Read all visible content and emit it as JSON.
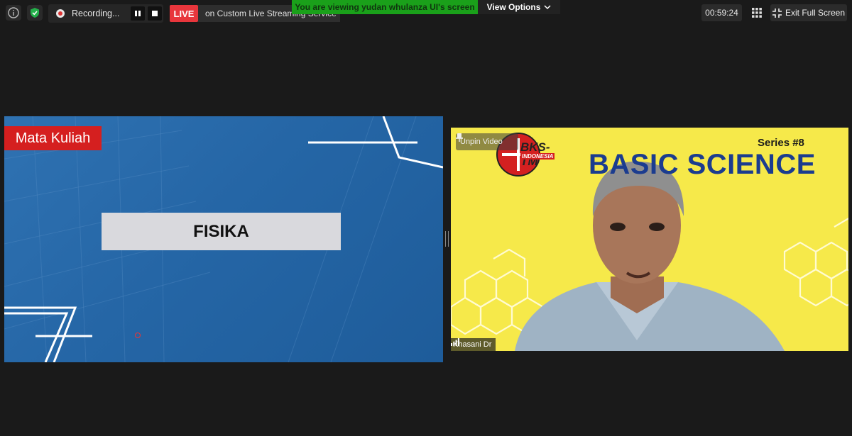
{
  "topbar": {
    "recording_label": "Recording...",
    "live_label": "LIVE",
    "stream_label": "on Custom Live Streaming Service",
    "viewing_banner": "You are viewing yudan whulanza UI's screen",
    "view_options_label": "View Options",
    "timer": "00:59:24",
    "exit_fullscreen_label": "Exit Full Screen"
  },
  "share": {
    "course_label": "Mata Kuliah",
    "subject_title": "FISIKA"
  },
  "video": {
    "series_label": "Series #8",
    "banner_title": "BASIC SCIENCE",
    "logo_text": "BKS-TM",
    "logo_subtext": "INDONESIA",
    "unpin_label": "Unpin Video",
    "participant_name": "Khasani Dr"
  },
  "colors": {
    "live_red": "#e8363c",
    "banner_green": "#1aa01a",
    "share_blue": "#2566a6",
    "video_yellow": "#f6e94a"
  }
}
